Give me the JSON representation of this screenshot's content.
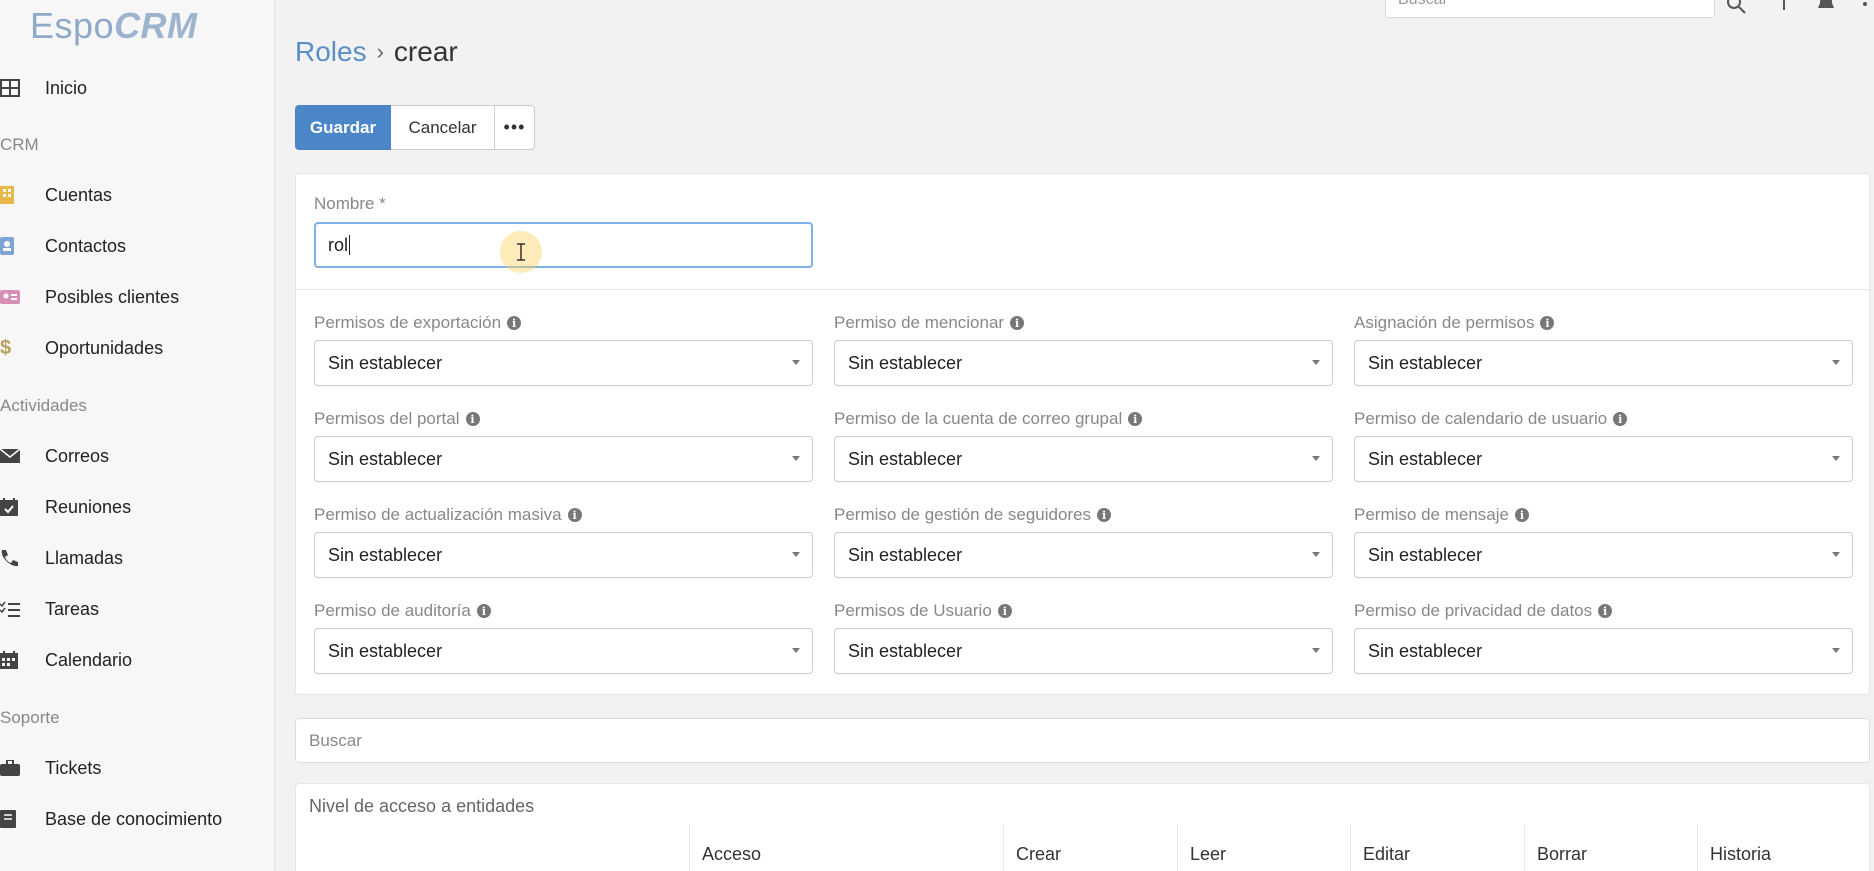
{
  "app": {
    "logo_main": "Espo",
    "logo_crm": "CRM"
  },
  "top_bar": {
    "search_placeholder": "Buscar"
  },
  "sidebar": {
    "items": [
      {
        "label": "Inicio",
        "icon": "grid-icon"
      },
      {
        "label": "Cuentas",
        "icon": "building-icon"
      },
      {
        "label": "Contactos",
        "icon": "contact-card-icon"
      },
      {
        "label": "Posibles clientes",
        "icon": "id-card-icon"
      },
      {
        "label": "Oportunidades",
        "icon": "dollar-icon"
      },
      {
        "label": "Correos",
        "icon": "envelope-icon"
      },
      {
        "label": "Reuniones",
        "icon": "calendar-check-icon"
      },
      {
        "label": "Llamadas",
        "icon": "phone-icon"
      },
      {
        "label": "Tareas",
        "icon": "task-list-icon"
      },
      {
        "label": "Calendario",
        "icon": "calendar-icon"
      },
      {
        "label": "Tickets",
        "icon": "briefcase-icon"
      },
      {
        "label": "Base de conocimiento",
        "icon": "book-icon"
      }
    ],
    "sections": [
      "CRM",
      "Actividades",
      "Soporte"
    ]
  },
  "header": {
    "breadcrumb_root": "Roles",
    "breadcrumb_sep": "›",
    "breadcrumb_current": "crear"
  },
  "toolbar": {
    "save_label": "Guardar",
    "cancel_label": "Cancelar",
    "more_label": "•••"
  },
  "form": {
    "name_label": "Nombre *",
    "name_value": "rol",
    "fields": [
      {
        "label": "Permisos de exportación",
        "value": "Sin establecer"
      },
      {
        "label": "Permiso de mencionar",
        "value": "Sin establecer"
      },
      {
        "label": "Asignación de permisos",
        "value": "Sin establecer"
      },
      {
        "label": "Permisos del portal",
        "value": "Sin establecer"
      },
      {
        "label": "Permiso de la cuenta de correo grupal",
        "value": "Sin establecer"
      },
      {
        "label": "Permiso de calendario de usuario",
        "value": "Sin establecer"
      },
      {
        "label": "Permiso de actualización masiva",
        "value": "Sin establecer"
      },
      {
        "label": "Permiso de gestión de seguidores",
        "value": "Sin establecer"
      },
      {
        "label": "Permiso de mensaje",
        "value": "Sin establecer"
      },
      {
        "label": "Permiso de auditoría",
        "value": "Sin establecer"
      },
      {
        "label": "Permisos de Usuario",
        "value": "Sin establecer"
      },
      {
        "label": "Permiso de privacidad de datos",
        "value": "Sin establecer"
      }
    ]
  },
  "search": {
    "placeholder": "Buscar"
  },
  "entity_access": {
    "title": "Nivel de acceso a entidades",
    "columns": [
      "Acceso",
      "Crear",
      "Leer",
      "Editar",
      "Borrar",
      "Historia"
    ]
  },
  "colors": {
    "accent": "#4a86c8",
    "link": "#5a8fc6"
  }
}
